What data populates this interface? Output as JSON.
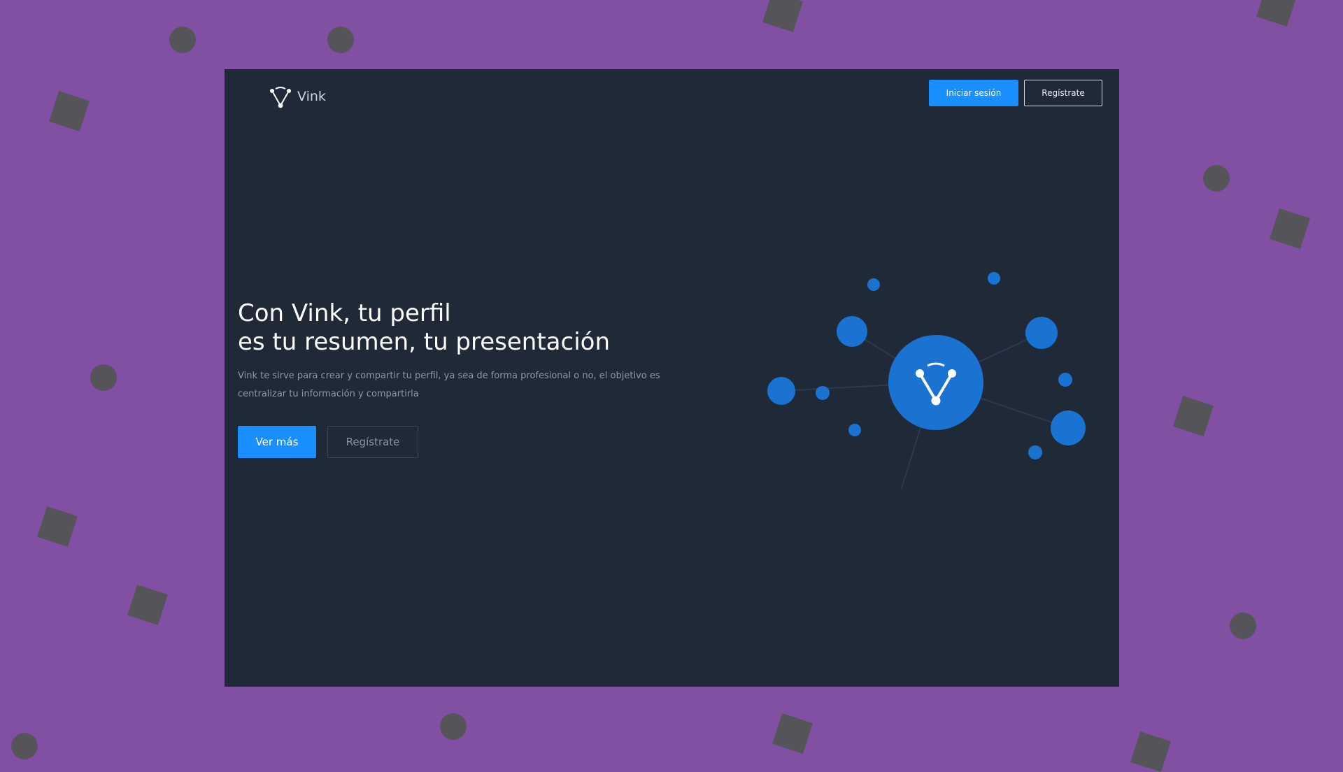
{
  "header": {
    "brand": "Vink",
    "login_label": "Iniciar sesión",
    "register_label": "Regístrate"
  },
  "hero": {
    "title_line1": "Con Vink, tu perfil",
    "title_line2": "es tu resumen, tu presentación",
    "description": "Vink te sirve para crear y compartir tu perfil, ya sea de forma profesional o no, el objetivo es centralizar tu información y compartirla",
    "more_label": "Ver más",
    "register_label": "Regístrate"
  },
  "colors": {
    "page_background": "#8250a3",
    "panel_background": "#1f2937",
    "accent": "#1a8fff",
    "node": "#1a73d0",
    "decor": "#555559"
  },
  "icons": {
    "logo": "vink-logo-icon",
    "hub": "vink-hub-icon"
  }
}
